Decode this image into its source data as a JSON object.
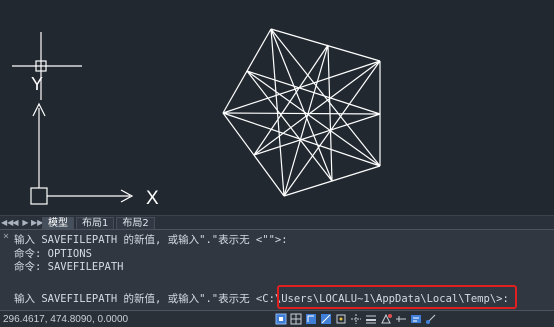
{
  "layout_tabs": {
    "nav_first": "◀◀",
    "nav_prev": "◀",
    "nav_next": "▶",
    "nav_last": "▶▶",
    "tabs": [
      {
        "label": "模型",
        "active": true
      },
      {
        "label": "布局1",
        "active": false
      },
      {
        "label": "布局2",
        "active": false
      }
    ]
  },
  "canvas": {
    "ucs_x_label": "X",
    "ucs_y_label": "Y"
  },
  "command_pane": {
    "close_glyph": "×",
    "history": [
      "输入 SAVEFILEPATH 的新值, 或输入\".\"表示无 <\"\">:",
      "命令: OPTIONS",
      "命令: SAVEFILEPATH"
    ],
    "prompt_text": "输入 SAVEFILEPATH 的新值, 或输入\".\"表示无 <C:\\Users\\LOCALU~1\\AppData\\Local\\Temp\\>:"
  },
  "statusbar": {
    "coordinates": "296.4617, 474.8090, 0.0000",
    "buttons": [
      "snap-icon",
      "grid-icon",
      "ortho-icon",
      "polar-icon",
      "osnap-icon",
      "otrack-icon",
      "lineweight-icon",
      "dyn-icon",
      "tpy-icon",
      "qp-icon",
      "sc-icon"
    ]
  },
  "colors": {
    "canvas_bg": "#212830",
    "geometry": "#ffffff",
    "highlight": "#e02020",
    "active_tool": "#3f7fd8"
  }
}
